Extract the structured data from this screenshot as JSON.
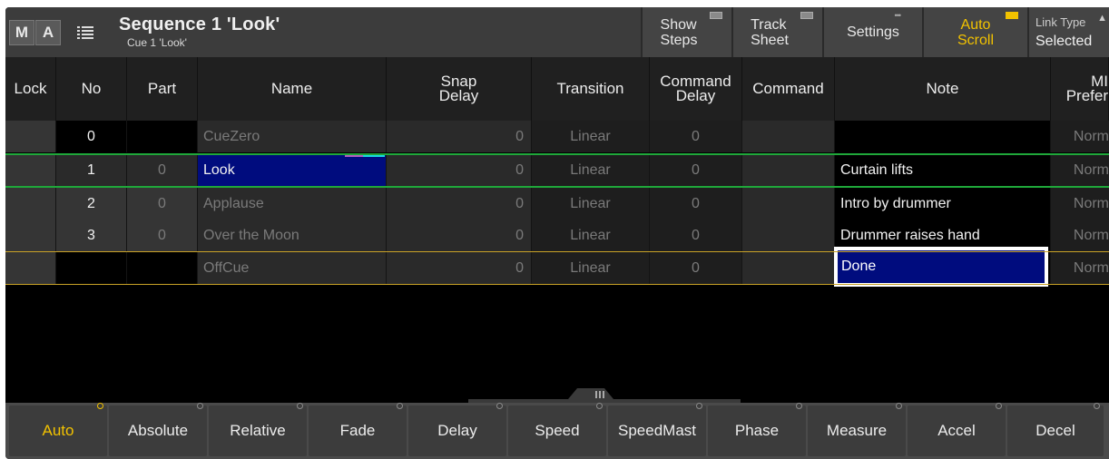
{
  "titlebar": {
    "logo": [
      "M",
      "A"
    ],
    "title": "Sequence 1 'Look'",
    "subtitle": "Cue 1 'Look'",
    "buttons": [
      {
        "label": "Show\nSteps",
        "active": false
      },
      {
        "label": "Track\nSheet",
        "active": false
      },
      {
        "label": "Settings",
        "active": false
      },
      {
        "label": "Auto\nScroll",
        "active": true
      }
    ],
    "link_type": {
      "label": "Link Type",
      "value": "Selected"
    }
  },
  "columns": [
    "Lock",
    "No",
    "Part",
    "Name",
    "Snap\nDelay",
    "Transition",
    "Command\nDelay",
    "Command",
    "Note",
    "MI\nPrefer"
  ],
  "rows": [
    {
      "no": "0",
      "part": "",
      "name": "CueZero",
      "snap": "0",
      "transition": "Linear",
      "cmd_delay": "0",
      "command": "",
      "note": "",
      "mib": "Norm"
    },
    {
      "no": "1",
      "part": "0",
      "name": "Look",
      "snap": "0",
      "transition": "Linear",
      "cmd_delay": "0",
      "command": "",
      "note": "Curtain lifts",
      "mib": "Norm"
    },
    {
      "no": "2",
      "part": "0",
      "name": "Applause",
      "snap": "0",
      "transition": "Linear",
      "cmd_delay": "0",
      "command": "",
      "note": "Intro by drummer",
      "mib": "Norm"
    },
    {
      "no": "3",
      "part": "0",
      "name": "Over the Moon",
      "snap": "0",
      "transition": "Linear",
      "cmd_delay": "0",
      "command": "",
      "note": "Drummer raises hand",
      "mib": "Norm"
    },
    {
      "no": "",
      "part": "",
      "name": "OffCue",
      "snap": "0",
      "transition": "Linear",
      "cmd_delay": "0",
      "command": "",
      "note": "Done",
      "mib": "Norm"
    }
  ],
  "bottom_buttons": [
    {
      "label": "Auto",
      "active": true
    },
    {
      "label": "Absolute",
      "active": false
    },
    {
      "label": "Relative",
      "active": false
    },
    {
      "label": "Fade",
      "active": false
    },
    {
      "label": "Delay",
      "active": false
    },
    {
      "label": "Speed",
      "active": false
    },
    {
      "label": "SpeedMast",
      "active": false
    },
    {
      "label": "Phase",
      "active": false
    },
    {
      "label": "Measure",
      "active": false
    },
    {
      "label": "Accel",
      "active": false
    },
    {
      "label": "Decel",
      "active": false
    }
  ],
  "colors": {
    "accent": "#f2c200",
    "selection": "#000c7e",
    "active_cue_line": "#1fa83a",
    "off_cue_line": "#c9a227"
  }
}
